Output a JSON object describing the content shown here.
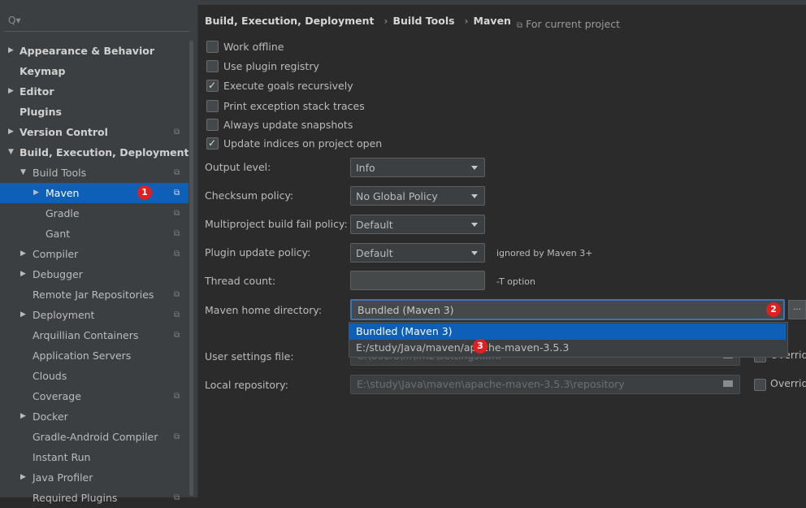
{
  "search": {
    "placeholder": "Q▾"
  },
  "sidebar": {
    "items": [
      {
        "label": "Appearance & Behavior",
        "arrow": "▶",
        "bold": true,
        "proj": false
      },
      {
        "label": "Keymap",
        "arrow": "",
        "bold": true,
        "proj": false
      },
      {
        "label": "Editor",
        "arrow": "▶",
        "bold": true,
        "proj": false
      },
      {
        "label": "Plugins",
        "arrow": "",
        "bold": true,
        "proj": false
      },
      {
        "label": "Version Control",
        "arrow": "▶",
        "bold": true,
        "proj": true
      },
      {
        "label": "Build, Execution, Deployment",
        "arrow": "▼",
        "bold": true,
        "proj": false
      },
      {
        "label": "Build Tools",
        "arrow": "▼",
        "bold": false,
        "proj": true
      },
      {
        "label": "Maven",
        "arrow": "▶",
        "bold": false,
        "proj": true,
        "selected": true
      },
      {
        "label": "Gradle",
        "arrow": "",
        "bold": false,
        "proj": true
      },
      {
        "label": "Gant",
        "arrow": "",
        "bold": false,
        "proj": true
      },
      {
        "label": "Compiler",
        "arrow": "▶",
        "bold": false,
        "proj": true
      },
      {
        "label": "Debugger",
        "arrow": "▶",
        "bold": false,
        "proj": false
      },
      {
        "label": "Remote Jar Repositories",
        "arrow": "",
        "bold": false,
        "proj": true
      },
      {
        "label": "Deployment",
        "arrow": "▶",
        "bold": false,
        "proj": true
      },
      {
        "label": "Arquillian Containers",
        "arrow": "",
        "bold": false,
        "proj": true
      },
      {
        "label": "Application Servers",
        "arrow": "",
        "bold": false,
        "proj": false
      },
      {
        "label": "Clouds",
        "arrow": "",
        "bold": false,
        "proj": false
      },
      {
        "label": "Coverage",
        "arrow": "",
        "bold": false,
        "proj": true
      },
      {
        "label": "Docker",
        "arrow": "▶",
        "bold": false,
        "proj": false
      },
      {
        "label": "Gradle-Android Compiler",
        "arrow": "",
        "bold": false,
        "proj": true
      },
      {
        "label": "Instant Run",
        "arrow": "",
        "bold": false,
        "proj": false
      },
      {
        "label": "Java Profiler",
        "arrow": "▶",
        "bold": false,
        "proj": false
      },
      {
        "label": "Required Plugins",
        "arrow": "",
        "bold": false,
        "proj": true
      }
    ]
  },
  "breadcrumb": {
    "parts": [
      "Build, Execution, Deployment",
      "Build Tools",
      "Maven"
    ],
    "separator": "›"
  },
  "scope_note": "For current project",
  "checkboxes": [
    {
      "label": "Work offline",
      "checked": false
    },
    {
      "label": "Use plugin registry",
      "checked": false
    },
    {
      "label": "Execute goals recursively",
      "checked": true
    },
    {
      "label": "Print exception stack traces",
      "checked": false
    },
    {
      "label": "Always update snapshots",
      "checked": false
    },
    {
      "label": "Update indices on project open",
      "checked": true
    }
  ],
  "fields": {
    "output_level": {
      "label": "Output level:",
      "value": "Info"
    },
    "checksum_policy": {
      "label": "Checksum policy:",
      "value": "No Global Policy"
    },
    "multiproject_fail": {
      "label": "Multiproject build fail policy:",
      "value": "Default"
    },
    "plugin_update": {
      "label": "Plugin update policy:",
      "value": "Default",
      "hint": "ignored by Maven 3+"
    },
    "thread_count": {
      "label": "Thread count:",
      "value": "",
      "hint": "-T option"
    },
    "maven_home": {
      "label": "Maven home directory:",
      "value": "Bundled (Maven 3)",
      "browse": "..."
    },
    "user_settings": {
      "label": "User settings file:",
      "value": "C:\\Users\\...\\.m2\\settings.xml",
      "override": "Override"
    },
    "local_repo": {
      "label": "Local repository:",
      "value": "E:\\study\\Java\\maven\\apache-maven-3.5.3\\repository",
      "override": "Override"
    }
  },
  "dropdown_options": [
    "Bundled (Maven 3)",
    "E:/study/Java/maven/apache-maven-3.5.3"
  ],
  "badges": [
    "1",
    "2",
    "3"
  ],
  "colors": {
    "selection": "#0d5fb8",
    "badge": "#e02020",
    "focus": "#3d73b8"
  },
  "icons": {
    "search": "search-icon",
    "project_scope": "project-scope-icon",
    "folder": "folder-icon"
  }
}
